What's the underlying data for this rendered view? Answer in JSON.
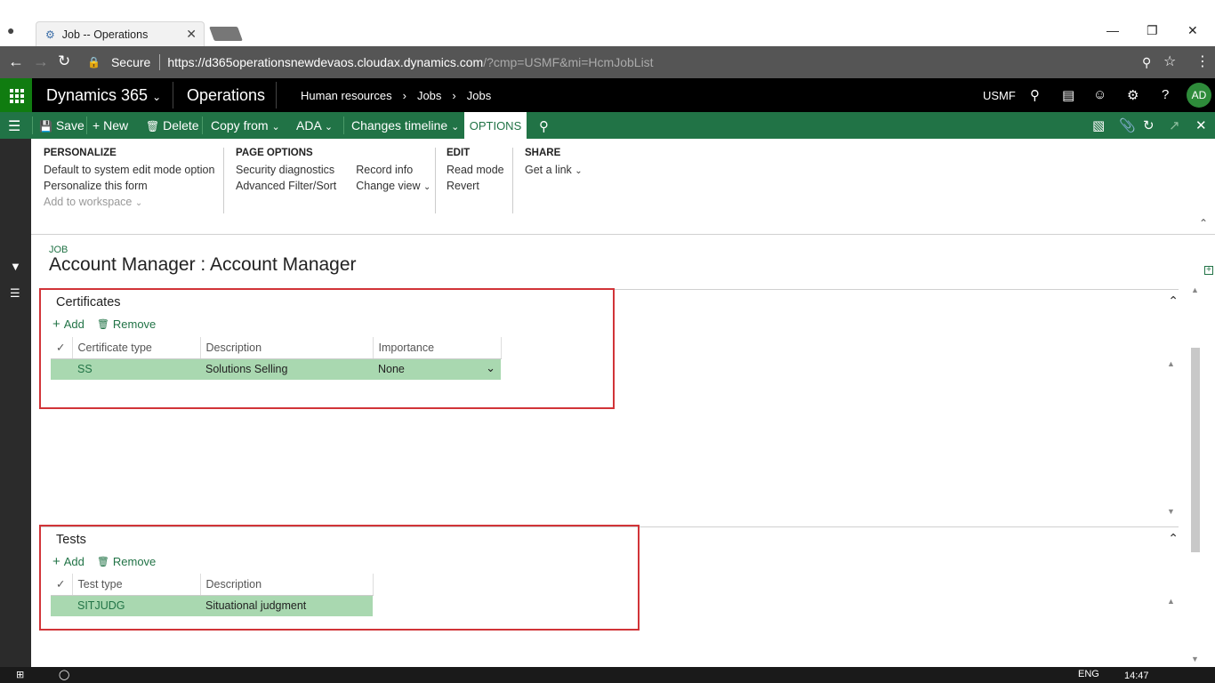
{
  "browser": {
    "tab_title": "Job -- Operations",
    "secure_label": "Secure",
    "url_host": "https://d365operationsnewdevaos.cloudax.dynamics.com",
    "url_query": "/?cmp=USMF&mi=HcmJobList"
  },
  "app": {
    "brand": "Dynamics 365",
    "module": "Operations",
    "breadcrumb": [
      "Human resources",
      "Jobs",
      "Jobs"
    ],
    "company": "USMF",
    "avatar_initials": "AD"
  },
  "actionpane": {
    "save": "Save",
    "new": "New",
    "delete": "Delete",
    "copy_from": "Copy from",
    "ada": "ADA",
    "changes_timeline": "Changes timeline",
    "options": "OPTIONS"
  },
  "ribbon": {
    "personalize": {
      "header": "PERSONALIZE",
      "items": [
        "Default to system edit mode option",
        "Personalize this form",
        "Add to workspace"
      ]
    },
    "page_options": {
      "header": "PAGE OPTIONS",
      "col1": [
        "Security diagnostics",
        "Advanced Filter/Sort"
      ],
      "col2": [
        "Record info",
        "Change view"
      ]
    },
    "edit": {
      "header": "EDIT",
      "items": [
        "Read mode",
        "Revert"
      ]
    },
    "share": {
      "header": "SHARE",
      "items": [
        "Get a link"
      ]
    }
  },
  "page": {
    "caption": "JOB",
    "title": "Account Manager : Account Manager"
  },
  "certificates": {
    "title": "Certificates",
    "add": "Add",
    "remove": "Remove",
    "columns": [
      "Certificate type",
      "Description",
      "Importance"
    ],
    "rows": [
      {
        "type": "SS",
        "description": "Solutions Selling",
        "importance": "None"
      }
    ]
  },
  "tests": {
    "title": "Tests",
    "add": "Add",
    "remove": "Remove",
    "columns": [
      "Test type",
      "Description"
    ],
    "rows": [
      {
        "type": "SITJUDG",
        "description": "Situational judgment"
      }
    ]
  },
  "taskbar": {
    "time": "14:47",
    "lang": "ENG"
  },
  "colors": {
    "brand_green": "#217346",
    "row_selected": "#a9d8b0",
    "highlight_red": "#d13438"
  }
}
